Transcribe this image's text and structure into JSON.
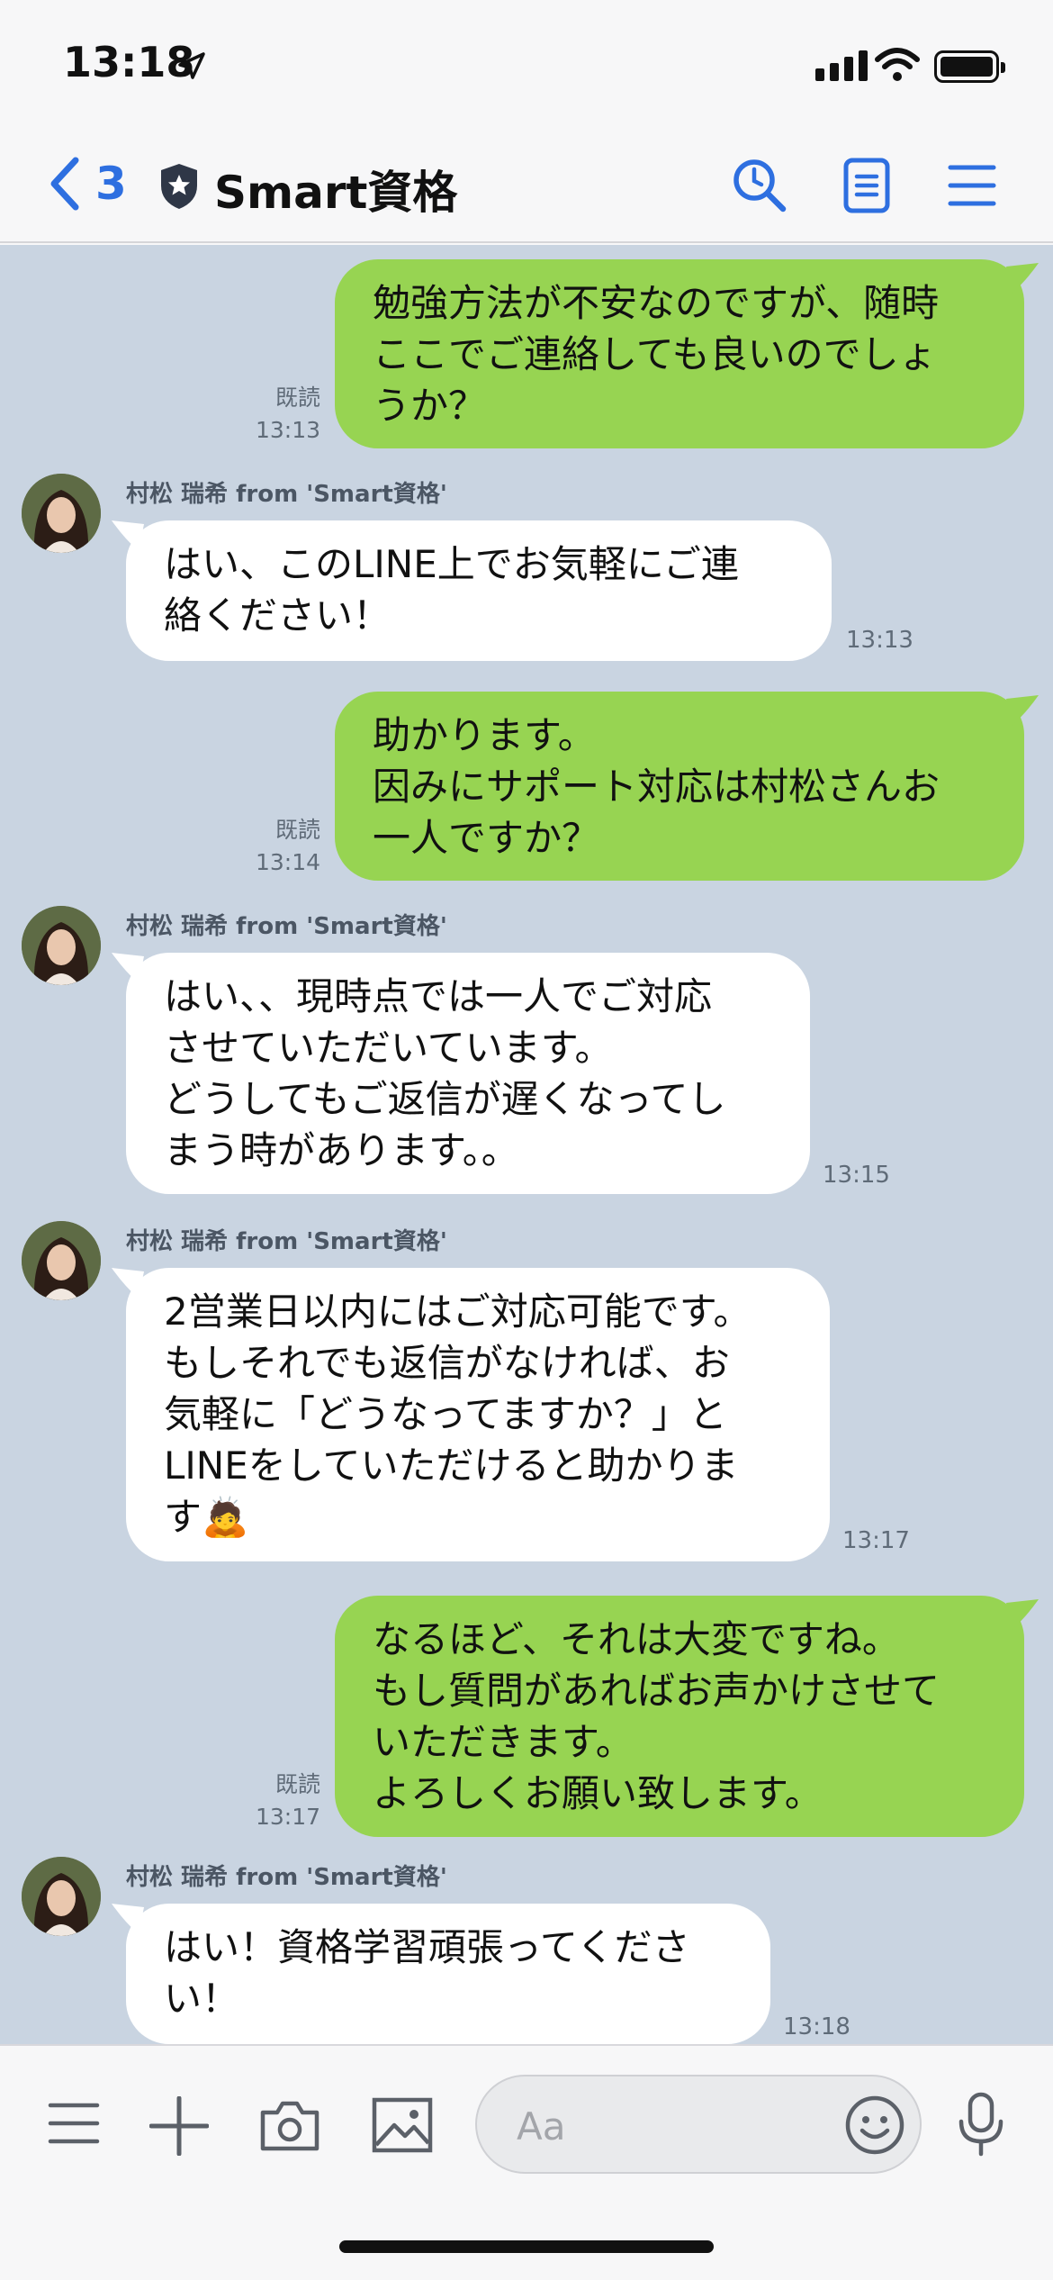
{
  "status_bar": {
    "time": "13:18"
  },
  "header": {
    "back_count": "3",
    "title": "Smart資格"
  },
  "messages": [
    {
      "lines": [
        "勉強方法が不安なのですが、随時",
        "ここでご連絡しても良いのでしょ",
        "うか？"
      ],
      "read": "既読",
      "time": "13:13"
    },
    {
      "sender": "村松 瑞希 from 'Smart資格'",
      "lines": [
        "はい、このLINE上でお気軽にご連",
        "絡ください！"
      ],
      "time": "13:13"
    },
    {
      "lines": [
        "助かります。",
        "因みにサポート対応は村松さんお",
        "一人ですか？"
      ],
      "read": "既読",
      "time": "13:14"
    },
    {
      "sender": "村松 瑞希 from 'Smart資格'",
      "lines": [
        "はい、、現時点では一人でご対応",
        "させていただいています。",
        "どうしてもご返信が遅くなってし",
        "まう時があります。。"
      ],
      "time": "13:15"
    },
    {
      "sender": "村松 瑞希 from 'Smart資格'",
      "lines": [
        "2営業日以内にはご対応可能です。",
        "もしそれでも返信がなければ、お",
        "気軽に「どうなってますか？」と",
        "LINEをしていただけると助かりま",
        "す🙇"
      ],
      "time": "13:17"
    },
    {
      "lines": [
        "なるほど、それは大変ですね。",
        "もし質問があればお声かけさせて",
        "いただきます。",
        "よろしくお願い致します。"
      ],
      "read": "既読",
      "time": "13:17"
    },
    {
      "sender": "村松 瑞希 from 'Smart資格'",
      "lines": [
        "はい！資格学習頑張ってくださ",
        "い！"
      ],
      "time": "13:18"
    }
  ],
  "input": {
    "placeholder": "Aa"
  },
  "icons": {
    "back": "chevron-left-icon",
    "verified": "shield-star-icon",
    "search": "search-icon",
    "notes": "notes-icon",
    "menu": "menu-icon",
    "input_menu": "menu-icon",
    "add": "plus-icon",
    "camera": "camera-icon",
    "image": "image-icon",
    "emoji": "emoji-icon",
    "mic": "microphone-icon"
  },
  "colors": {
    "accent": "#2e6fe0",
    "my_bubble": "#97d452",
    "their_bubble": "#ffffff",
    "chat_bg": "#c9d4e1"
  }
}
